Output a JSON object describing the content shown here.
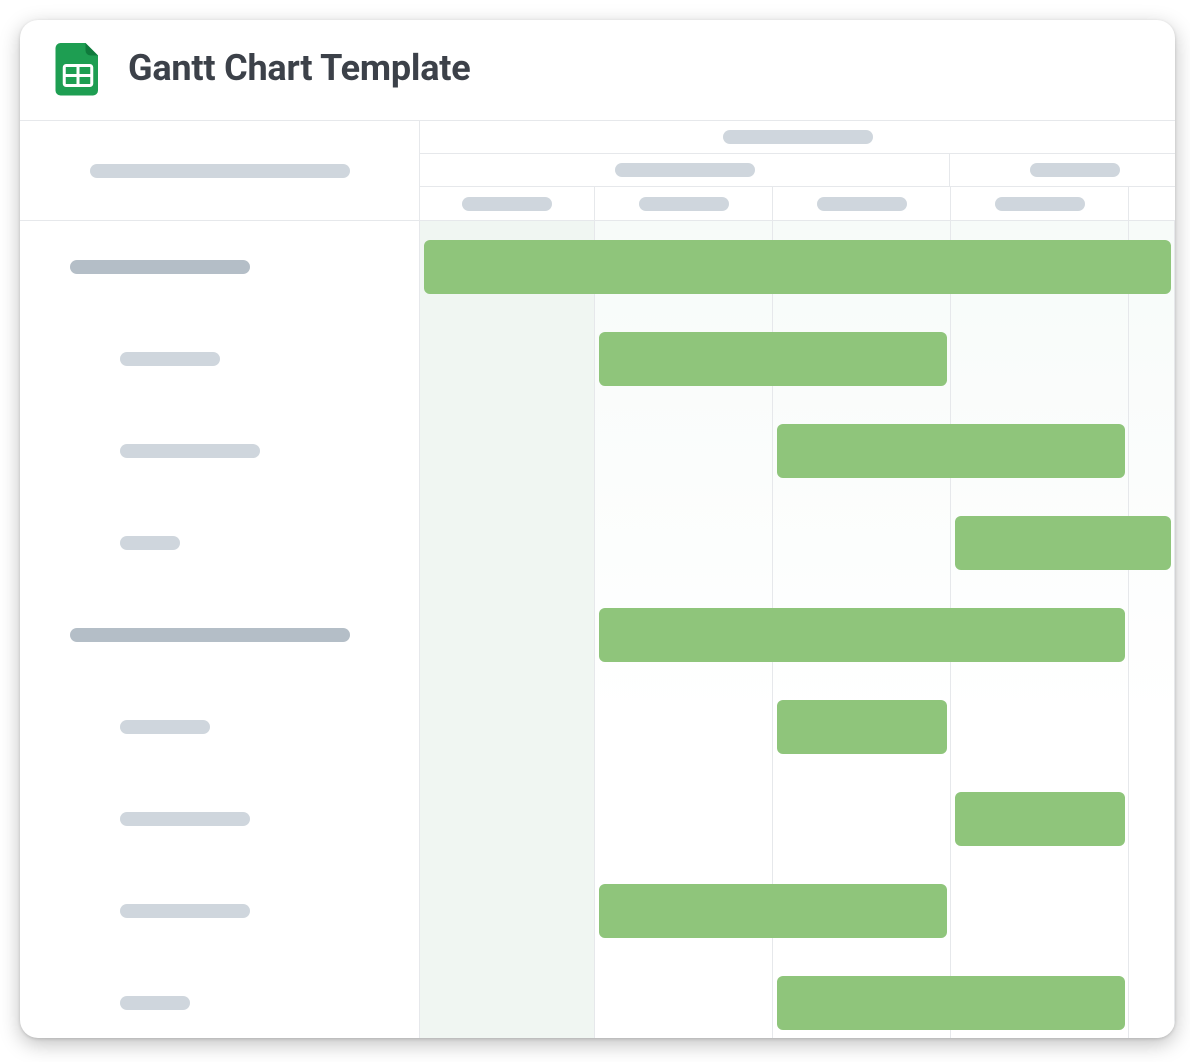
{
  "header": {
    "title": "Gantt Chart Template",
    "icon_name": "google-sheets-icon"
  },
  "chart_data": {
    "type": "gantt",
    "columns_visible": 5,
    "tasks": [
      {
        "kind": "group",
        "label_width": 180,
        "start": 0,
        "span": 5
      },
      {
        "kind": "task",
        "label_width": 100,
        "start": 1,
        "span": 2
      },
      {
        "kind": "task",
        "label_width": 140,
        "start": 2,
        "span": 2
      },
      {
        "kind": "task",
        "label_width": 60,
        "start": 3,
        "span": 2
      },
      {
        "kind": "group",
        "label_width": 280,
        "start": 1,
        "span": 3
      },
      {
        "kind": "task",
        "label_width": 90,
        "start": 2,
        "span": 1
      },
      {
        "kind": "task",
        "label_width": 130,
        "start": 3,
        "span": 1
      },
      {
        "kind": "task",
        "label_width": 130,
        "start": 1,
        "span": 2
      },
      {
        "kind": "task",
        "label_width": 70,
        "start": 2,
        "span": 2
      }
    ]
  },
  "colors": {
    "bar": "#8fc57b",
    "placeholder": "#cfd6dd",
    "placeholder_dark": "#b4bec7",
    "border": "#e6e8eb"
  }
}
